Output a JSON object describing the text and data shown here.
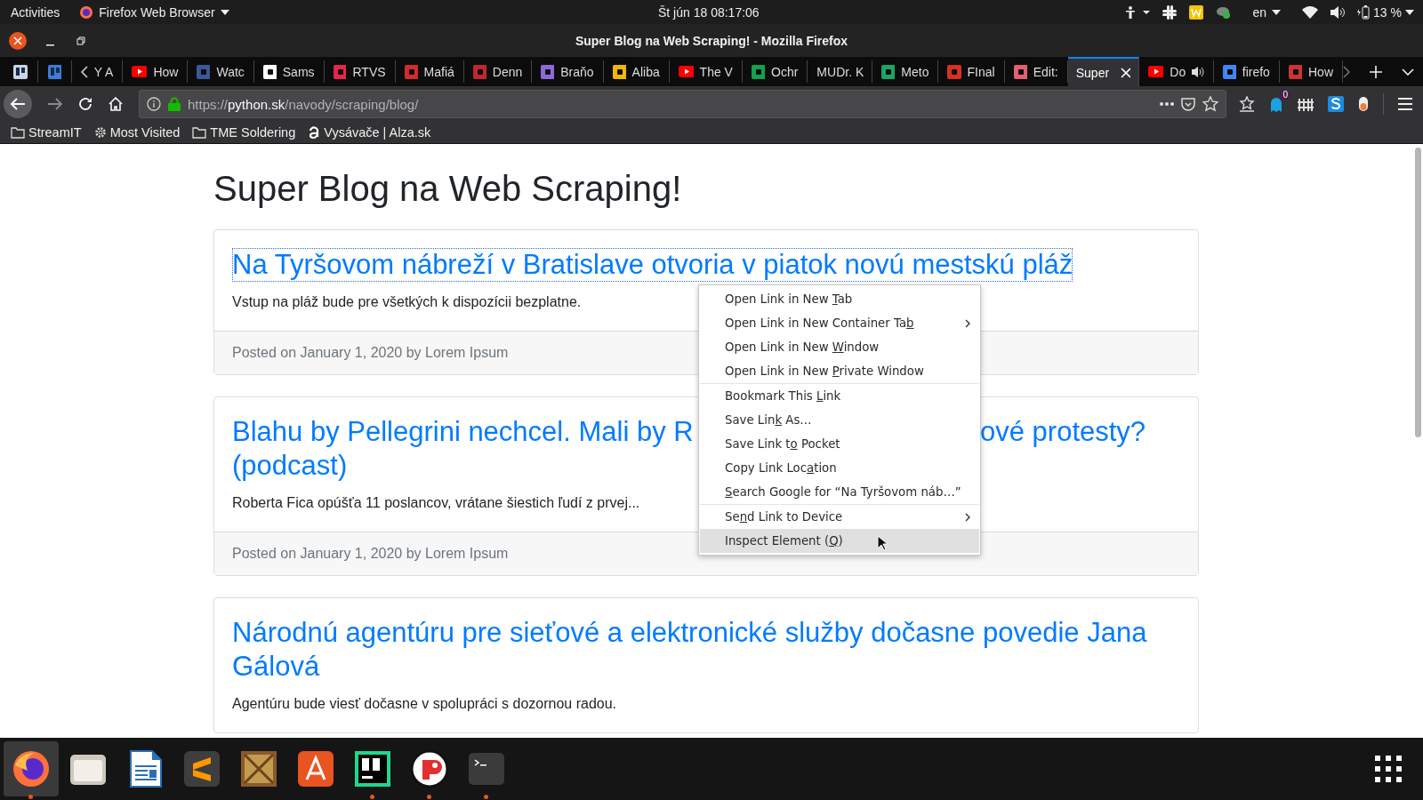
{
  "top_bar": {
    "activities": "Activities",
    "app_menu": "Firefox Web Browser",
    "clock": "Št jún 18  08:17:06",
    "language": "en",
    "battery": "13 %"
  },
  "window": {
    "title": "Super Blog na Web Scraping! - Mozilla Firefox"
  },
  "tabs": [
    {
      "kind": "pinned",
      "color": "#c9d4e6",
      "selected": false,
      "playing": false
    },
    {
      "kind": "pinned",
      "color": "#3b7dd8",
      "selected": false,
      "playing": false
    },
    {
      "label": "Y A",
      "kind": "none",
      "selected": false,
      "playing": false
    },
    {
      "label": "How",
      "kind": "play",
      "color": "#ff0000",
      "selected": false,
      "playing": false
    },
    {
      "label": "Watc",
      "kind": "square",
      "color": "#3b5998",
      "selected": false,
      "playing": false
    },
    {
      "label": "Sams",
      "kind": "square",
      "color": "#ffffff",
      "selected": false,
      "playing": false
    },
    {
      "label": "RTVS",
      "kind": "square",
      "color": "#e5254b",
      "selected": false,
      "playing": false
    },
    {
      "label": "Mafiá",
      "kind": "square",
      "color": "#d12c2c",
      "selected": false,
      "playing": false
    },
    {
      "label": "Denn",
      "kind": "square",
      "color": "#c0282d",
      "selected": false,
      "playing": false
    },
    {
      "label": "Braňo",
      "kind": "square",
      "color": "#8e6ad8",
      "selected": false,
      "playing": false
    },
    {
      "label": "Aliba",
      "kind": "square",
      "color": "#f2b705",
      "selected": false,
      "playing": false
    },
    {
      "label": "The V",
      "kind": "play",
      "color": "#ff0000",
      "selected": false,
      "playing": false
    },
    {
      "label": "Ochr",
      "kind": "square",
      "color": "#12a150",
      "selected": false,
      "playing": false
    },
    {
      "label": "MUDr. K",
      "kind": "none",
      "selected": false,
      "playing": false
    },
    {
      "label": "Meto",
      "kind": "square",
      "color": "#1fa463",
      "selected": false,
      "playing": false
    },
    {
      "label": "FInal",
      "kind": "square",
      "color": "#d93025",
      "selected": false,
      "playing": false
    },
    {
      "label": "Edit:",
      "kind": "square",
      "color": "#e06070",
      "selected": false,
      "playing": false
    },
    {
      "label": "Super",
      "kind": "none",
      "selected": true,
      "playing": false
    },
    {
      "label": "Do",
      "kind": "play",
      "color": "#ff0000",
      "selected": false,
      "playing": true
    },
    {
      "label": "firefo",
      "kind": "square",
      "color": "#4285f4",
      "selected": false,
      "playing": false
    },
    {
      "label": "How",
      "kind": "square",
      "color": "#cc3333",
      "selected": false,
      "playing": false
    }
  ],
  "url_bar": {
    "scheme": "https://",
    "host": "python.sk",
    "path": "/navody/scraping/blog/"
  },
  "toolbar_badge": "0",
  "bookmarks": [
    {
      "label": "StreamIT",
      "kind": "folder"
    },
    {
      "label": "Most Visited",
      "kind": "gear"
    },
    {
      "label": "TME Soldering",
      "kind": "folder"
    },
    {
      "label": "Vysávače | Alza.sk",
      "kind": "site"
    }
  ],
  "page": {
    "heading": "Super Blog na Web Scraping!",
    "articles": [
      {
        "title": [
          "Na Tyršovom nábreží v Bratislave otvoria v piatok novú mestskú pláž"
        ],
        "focused": true,
        "summary": "Vstup na pláž bude pre všetkých k dispozícii bezplatne.",
        "footer": "Posted on January 1, 2020 by Lorem Ipsum"
      },
      {
        "title": [
          "Blahu by Pellegrini nechcel. Mali by R",
          "ové protesty?",
          "(podcast)"
        ],
        "focused": false,
        "summary": "Roberta Fica opúšťa 11 poslancov, vrátane šiestich ľudí z prvej...",
        "footer": "Posted on January 1, 2020 by Lorem Ipsum"
      },
      {
        "title": [
          "Národnú agentúru pre sieťové a elektronické služby dočasne povedie Jana Gálová"
        ],
        "focused": false,
        "summary": "Agentúru bude viesť dočasne v spolupráci s dozornou radou."
      }
    ]
  },
  "context_menu": [
    {
      "before": "Open Link in New ",
      "key": "T",
      "after": "ab",
      "submenu": false,
      "separator_after": false,
      "selected": false
    },
    {
      "before": "Open Link in New Container Ta",
      "key": "b",
      "submenu": true,
      "separator_after": false,
      "selected": false
    },
    {
      "before": "Open Link in New ",
      "key": "W",
      "after": "indow",
      "submenu": false,
      "separator_after": false,
      "selected": false
    },
    {
      "before": "Open Link in New ",
      "key": "P",
      "after": "rivate Window",
      "submenu": false,
      "separator_after": true,
      "selected": false
    },
    {
      "before": "Bookmark This ",
      "key": "L",
      "after": "ink",
      "submenu": false,
      "separator_after": false,
      "selected": false
    },
    {
      "before": "Save Lin",
      "key": "k",
      "after": " As…",
      "submenu": false,
      "separator_after": false,
      "selected": false
    },
    {
      "before": "Save Link t",
      "key": "o",
      "after": " Pocket",
      "submenu": false,
      "separator_after": false,
      "selected": false
    },
    {
      "before": "Copy Link Loc",
      "key": "a",
      "after": "tion",
      "submenu": false,
      "separator_after": false,
      "selected": false
    },
    {
      "key": "S",
      "after": "earch Google for “Na Tyršovom náb…”",
      "submenu": false,
      "separator_after": true,
      "selected": false
    },
    {
      "before": "Se",
      "key": "n",
      "after": "d Link to Device",
      "submenu": true,
      "separator_after": false,
      "selected": false
    },
    {
      "before": "Inspect Element (",
      "key": "Q",
      "after": ")",
      "submenu": false,
      "separator_after": false,
      "selected": true
    }
  ],
  "dock": [
    {
      "kind": "firefox",
      "running": true,
      "selected": true
    },
    {
      "kind": "files",
      "running": false,
      "selected": false
    },
    {
      "kind": "writer",
      "running": false,
      "selected": false
    },
    {
      "kind": "sublime",
      "running": false,
      "selected": false
    },
    {
      "kind": "dosbox",
      "running": false,
      "selected": false
    },
    {
      "kind": "software",
      "running": false,
      "selected": false
    },
    {
      "kind": "pycharm",
      "running": true,
      "selected": false
    },
    {
      "kind": "redapp",
      "running": true,
      "selected": false
    },
    {
      "kind": "terminal",
      "running": true,
      "selected": false
    }
  ]
}
